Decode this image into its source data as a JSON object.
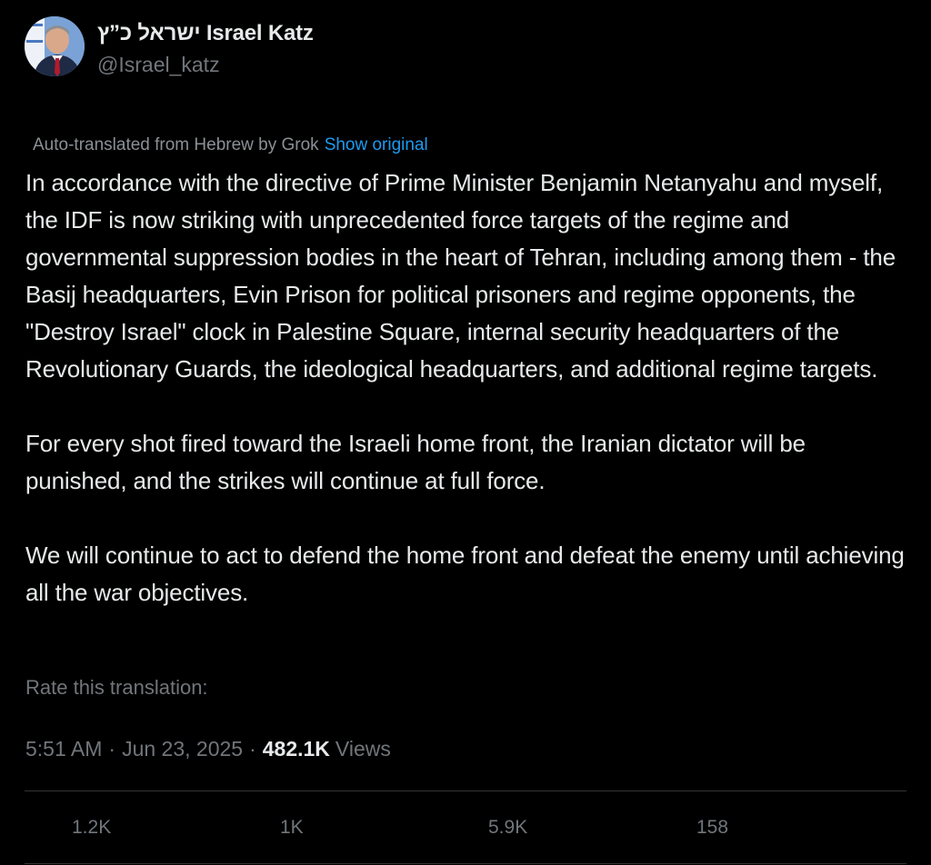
{
  "author": {
    "display_name_hebrew": "ישראל כ”ץ",
    "display_name_latin": "Israel Katz",
    "handle": "@Israel_katz"
  },
  "translation": {
    "note": "Auto-translated from Hebrew by Grok",
    "show_original_label": "Show original",
    "rate_label": "Rate this translation:"
  },
  "body": {
    "paragraphs": [
      "In accordance with the directive of Prime Minister Benjamin Netanyahu and myself, the IDF is now striking with unprecedented force targets of the regime and governmental suppression bodies in the heart of Tehran, including among them - the Basij headquarters, Evin Prison for political prisoners and regime opponents, the \"Destroy Israel\" clock in Palestine Square, internal security headquarters of the Revolutionary Guards, the ideological headquarters, and additional regime targets.",
      "For every shot fired toward the Israeli home front, the Iranian dictator will be punished, and the strikes will continue at full force.",
      "We will continue to act to defend the home front and defeat the enemy until achieving all the war objectives."
    ]
  },
  "meta": {
    "time": "5:51 AM",
    "separator": "·",
    "date": "Jun 23, 2025",
    "views_count": "482.1K",
    "views_label": "Views"
  },
  "actions": {
    "replies": "1.2K",
    "reposts": "1K",
    "likes": "5.9K",
    "bookmarks": "158"
  },
  "colors": {
    "background": "#000000",
    "text_primary": "#e7e9ea",
    "text_secondary": "#71767b",
    "link": "#1d9bf0",
    "divider": "#2f3336"
  }
}
